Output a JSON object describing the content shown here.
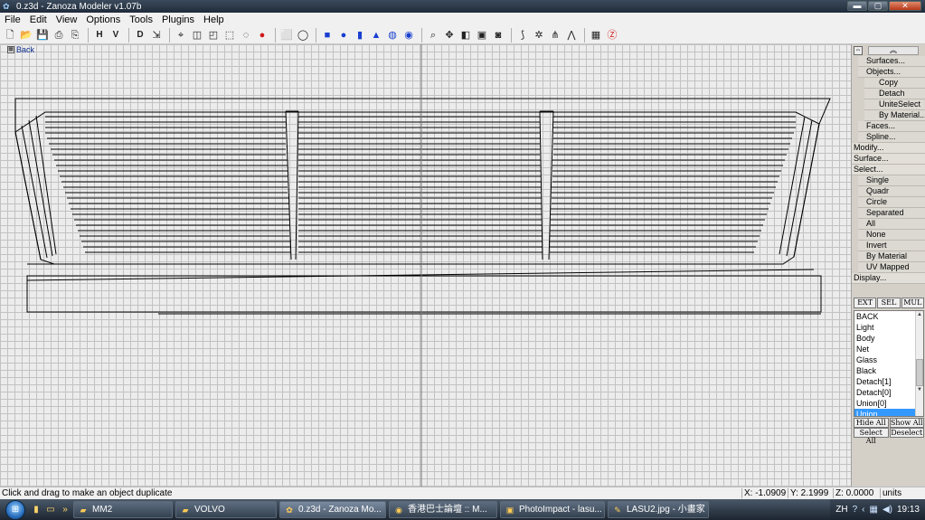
{
  "window": {
    "title": "0.z3d - Zanoza Modeler v1.07b",
    "controls": {
      "minimize": "▬",
      "maximize": "▢",
      "close": "✕"
    }
  },
  "menu": [
    "File",
    "Edit",
    "View",
    "Options",
    "Tools",
    "Plugins",
    "Help"
  ],
  "toolbar": {
    "h_label": "H",
    "v_label": "V",
    "d_label": "D",
    "icons": [
      "new-file-icon",
      "open-folder-icon",
      "save-icon",
      "save-as-icon",
      "print-icon",
      "pick-mode-icon",
      "move-icon",
      "rotate-icon",
      "scale-icon",
      "cube-icon",
      "sphere-icon",
      "red-sphere-icon",
      "select-box-icon",
      "select-circle-icon",
      "box-primitive-icon",
      "sphere-primitive-icon",
      "cylinder-primitive-icon",
      "cone-primitive-icon",
      "torus-primitive-icon",
      "disc-primitive-icon",
      "zoom-icon",
      "pan-icon",
      "view-front-icon",
      "view-all-icon",
      "camera-icon",
      "bend-icon",
      "twist-icon",
      "taper-icon",
      "stretch-icon",
      "grid-icon",
      "z-icon"
    ]
  },
  "viewport": {
    "label": "Back",
    "colors": {
      "background": "#ececec",
      "grid": "#c2c2c2",
      "wire": "#000000"
    }
  },
  "operations": [
    {
      "label": "Surfaces...",
      "level": 1
    },
    {
      "label": "Objects...",
      "level": 1
    },
    {
      "label": "Copy",
      "level": 2
    },
    {
      "label": "Detach",
      "level": 2
    },
    {
      "label": "UniteSelect",
      "level": 2
    },
    {
      "label": "By Material...",
      "level": 2
    },
    {
      "label": "Faces...",
      "level": 1
    },
    {
      "label": "Spline...",
      "level": 1
    },
    {
      "label": "Modify...",
      "level": 0
    },
    {
      "label": "Surface...",
      "level": 0
    },
    {
      "label": "Select...",
      "level": 0
    },
    {
      "label": "Single",
      "level": 1
    },
    {
      "label": "Quadr",
      "level": 1
    },
    {
      "label": "Circle",
      "level": 1
    },
    {
      "label": "Separated",
      "level": 1
    },
    {
      "label": "All",
      "level": 1
    },
    {
      "label": "None",
      "level": 1
    },
    {
      "label": "Invert",
      "level": 1
    },
    {
      "label": "By Material",
      "level": 1
    },
    {
      "label": "UV Mapped",
      "level": 1
    },
    {
      "label": "Display...",
      "level": 0
    }
  ],
  "mode_tabs": [
    "EXT",
    "SEL",
    "MUL"
  ],
  "materials": [
    "BACK",
    "Light",
    "Body",
    "Net",
    "Glass",
    "Black",
    "Detach[1]",
    "Detach[0]",
    "Union[0]",
    "Union"
  ],
  "selected_material": "Union",
  "list_buttons": [
    "Hide All",
    "Show All",
    "Select All",
    "Deselect"
  ],
  "status": {
    "hint": "Click and drag to make an object duplicate",
    "x": "X: -1.0909",
    "y": "Y: 2.1999",
    "z": "Z: 0.0000",
    "units": "units"
  },
  "taskbar": {
    "tasks": [
      {
        "label": "MM2",
        "icon": "folder-icon",
        "active": false
      },
      {
        "label": "VOLVO",
        "icon": "folder-icon",
        "active": false
      },
      {
        "label": "0.z3d - Zanoza Mo...",
        "icon": "zanoza-icon",
        "active": true
      },
      {
        "label": "香港巴士論壇 :: M...",
        "icon": "chrome-icon",
        "active": false
      },
      {
        "label": "PhotoImpact - lasu...",
        "icon": "photoimpact-icon",
        "active": false
      },
      {
        "label": "LASU2.jpg - 小畫家",
        "icon": "paint-icon",
        "active": false
      }
    ],
    "tray_lang": "ZH",
    "clock": "19:13"
  }
}
